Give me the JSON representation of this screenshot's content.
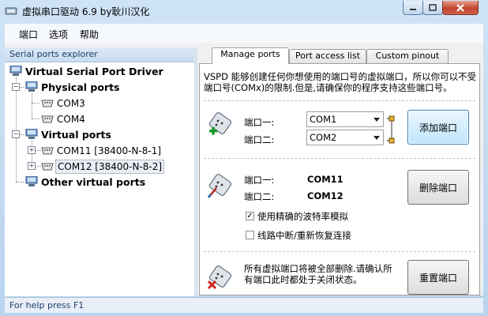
{
  "window": {
    "title": "虚拟串口驱动 6.9 by耿川汉化"
  },
  "menu": [
    "端口",
    "选项",
    "帮助"
  ],
  "explorer": {
    "header": "Serial ports explorer",
    "root": "Virtual Serial Port Driver",
    "groups": [
      {
        "label": "Physical ports",
        "items": [
          "COM3",
          "COM4"
        ]
      },
      {
        "label": "Virtual ports",
        "items": [
          "COM11 [38400-N-8-1]",
          "COM12 [38400-N-8-2]"
        ]
      },
      {
        "label": "Other virtual ports",
        "items": []
      }
    ]
  },
  "tabs": [
    "Manage ports",
    "Port access list",
    "Custom pinout"
  ],
  "manage": {
    "intro": "VSPD 能够创建任何你想使用的端口号的虚拟端口，所以你可以不受端口号(COMx)的限制.但是,请确保你的程序支持这些端口号。",
    "add": {
      "port1_label": "端口一:",
      "port2_label": "端口二:",
      "port1_value": "COM1",
      "port2_value": "COM2",
      "button": "添加端口"
    },
    "remove": {
      "port1_label": "端口一:",
      "port2_label": "端口二:",
      "port1_value": "COM11",
      "port2_value": "COM12",
      "button": "删除端口",
      "opt_baud": "使用精确的波特率模拟",
      "opt_baud_checked": true,
      "opt_break": "线路中断/重新恢复连接",
      "opt_break_checked": false
    },
    "reset": {
      "desc": "所有虚拟端口将被全部删除.请确认所有端口此时都处于关闭状态。",
      "button": "重置端口"
    }
  },
  "status": "For help press F1"
}
